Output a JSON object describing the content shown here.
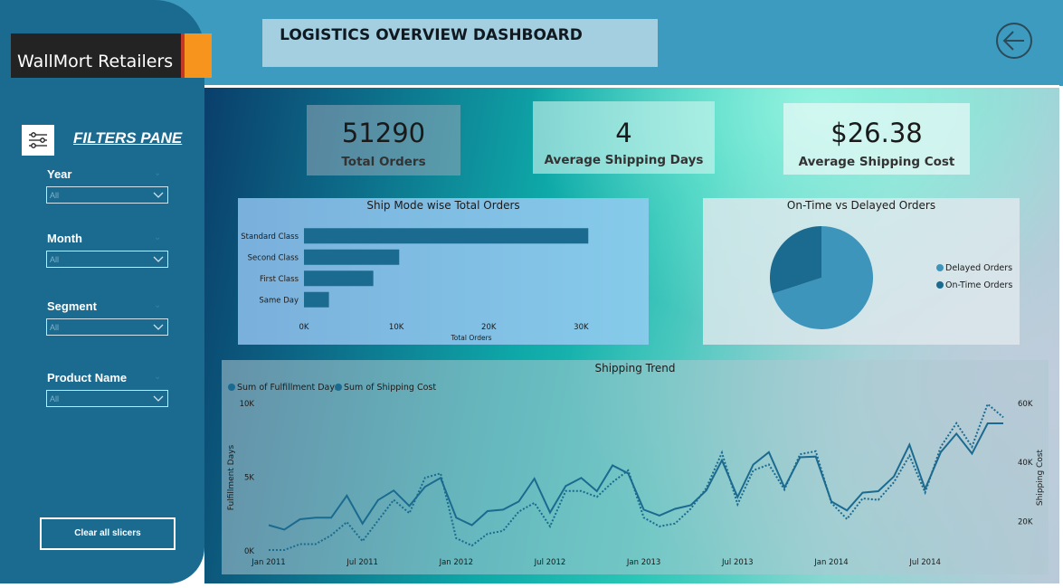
{
  "brand": {
    "name": "WallMort Retailers"
  },
  "header": {
    "title": "LOGISTICS OVERVIEW DASHBOARD"
  },
  "filters": {
    "title": "FILTERS PANE",
    "items": [
      {
        "label": "Year",
        "value": "All"
      },
      {
        "label": "Month",
        "value": "All"
      },
      {
        "label": "Segment",
        "value": "All"
      },
      {
        "label": "Product Name",
        "value": "All"
      }
    ],
    "clear_label": "Clear all slicers"
  },
  "kpis": [
    {
      "value": "51290",
      "label": "Total Orders"
    },
    {
      "value": "4",
      "label": "Average Shipping Days"
    },
    {
      "value": "$26.38",
      "label": "Average Shipping Cost"
    }
  ],
  "colors": {
    "sidebar": "#1b6a8f",
    "header": "#3d9bbf",
    "bar": "#1b6a8f",
    "series_primary": "#1b6a8f",
    "pie_light": "#3d95bb"
  },
  "chart_data": [
    {
      "type": "bar",
      "orientation": "horizontal",
      "title": "Ship Mode wise Total Orders",
      "categories": [
        "Standard Class",
        "Second Class",
        "First Class",
        "Same Day"
      ],
      "values": [
        30775,
        10309,
        7505,
        2701
      ],
      "xlabel": "Total Orders",
      "xticks": [
        "0K",
        "10K",
        "20K",
        "30K"
      ],
      "xlim": [
        0,
        33000
      ]
    },
    {
      "type": "pie",
      "title": "On-Time vs Delayed Orders",
      "labels": [
        "Delayed Orders",
        "On-Time Orders"
      ],
      "values": [
        70,
        30
      ],
      "colors": [
        "#3d95bb",
        "#1b6a8f"
      ],
      "legend": "right"
    },
    {
      "type": "line",
      "title": "Shipping Trend",
      "xlabel": "",
      "ylabel": "Fulfillment Days",
      "y2label": "Shipping Cost",
      "legend": "top-left",
      "xticks": [
        "Jan 2011",
        "Jul 2011",
        "Jan 2012",
        "Jul 2012",
        "Jan 2013",
        "Jul 2013",
        "Jan 2014",
        "Jul 2014"
      ],
      "yticks": [
        "0K",
        "5K",
        "10K"
      ],
      "y2ticks": [
        "20K",
        "40K",
        "60K"
      ],
      "ylim": [
        0,
        10000
      ],
      "y2lim": [
        10000,
        60000
      ],
      "series": [
        {
          "name": "Sum of Fulfillment Days",
          "axis": "left",
          "style": "solid",
          "values": [
            1750,
            1450,
            2150,
            2250,
            2250,
            3750,
            1850,
            3450,
            4100,
            3050,
            4350,
            4950,
            2250,
            1750,
            2700,
            2800,
            3350,
            4900,
            2600,
            4400,
            4950,
            4050,
            5800,
            5250,
            2800,
            2400,
            2850,
            3100,
            4100,
            6150,
            3650,
            5850,
            6700,
            4300,
            6350,
            6400,
            3350,
            2750,
            3950,
            4050,
            5050,
            7200,
            4200,
            6700,
            7950,
            6600,
            8650,
            8650
          ]
        },
        {
          "name": "Sum of Shipping Cost",
          "axis": "right",
          "style": "dotted",
          "values": [
            10300,
            10300,
            12300,
            12300,
            15300,
            19800,
            13300,
            20300,
            27300,
            22800,
            34800,
            36300,
            14300,
            11800,
            15800,
            16800,
            23300,
            26300,
            18300,
            30300,
            30300,
            28300,
            33300,
            37300,
            21300,
            18300,
            19300,
            24300,
            31300,
            43300,
            25800,
            37300,
            39300,
            30800,
            42800,
            43800,
            26300,
            20800,
            27800,
            27300,
            33300,
            42300,
            29800,
            45300,
            53300,
            45300,
            59800,
            55300
          ]
        }
      ]
    }
  ]
}
